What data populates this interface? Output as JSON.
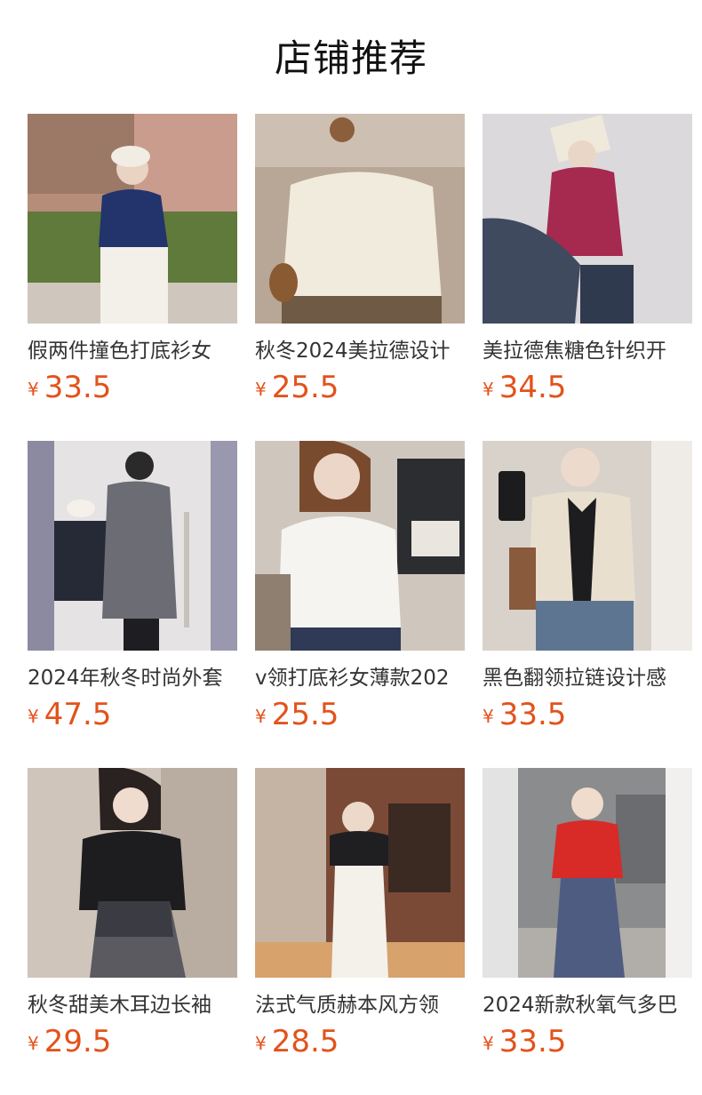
{
  "header": {
    "title": "店铺推荐"
  },
  "currency_symbol": "¥",
  "products": [
    {
      "name": "假两件撞色打底衫女",
      "price": "33.5",
      "image_icon": "product-photo-navy-top"
    },
    {
      "name": "秋冬2024美拉德设计",
      "price": "25.5",
      "image_icon": "product-photo-cream-knit"
    },
    {
      "name": "美拉德焦糖色针织开",
      "price": "34.5",
      "image_icon": "product-photo-berry-cardigan"
    },
    {
      "name": "2024年秋冬时尚外套",
      "price": "47.5",
      "image_icon": "product-photo-grey-coat"
    },
    {
      "name": "v领打底衫女薄款202",
      "price": "25.5",
      "image_icon": "product-photo-white-vneck"
    },
    {
      "name": "黑色翻领拉链设计感",
      "price": "33.5",
      "image_icon": "product-photo-zip-collar"
    },
    {
      "name": "秋冬甜美木耳边长袖",
      "price": "29.5",
      "image_icon": "product-photo-black-sweater-plaid-skirt"
    },
    {
      "name": "法式气质赫本风方领",
      "price": "28.5",
      "image_icon": "product-photo-white-dress"
    },
    {
      "name": "2024新款秋氧气多巴",
      "price": "33.5",
      "image_icon": "product-photo-red-cardigan"
    }
  ]
}
